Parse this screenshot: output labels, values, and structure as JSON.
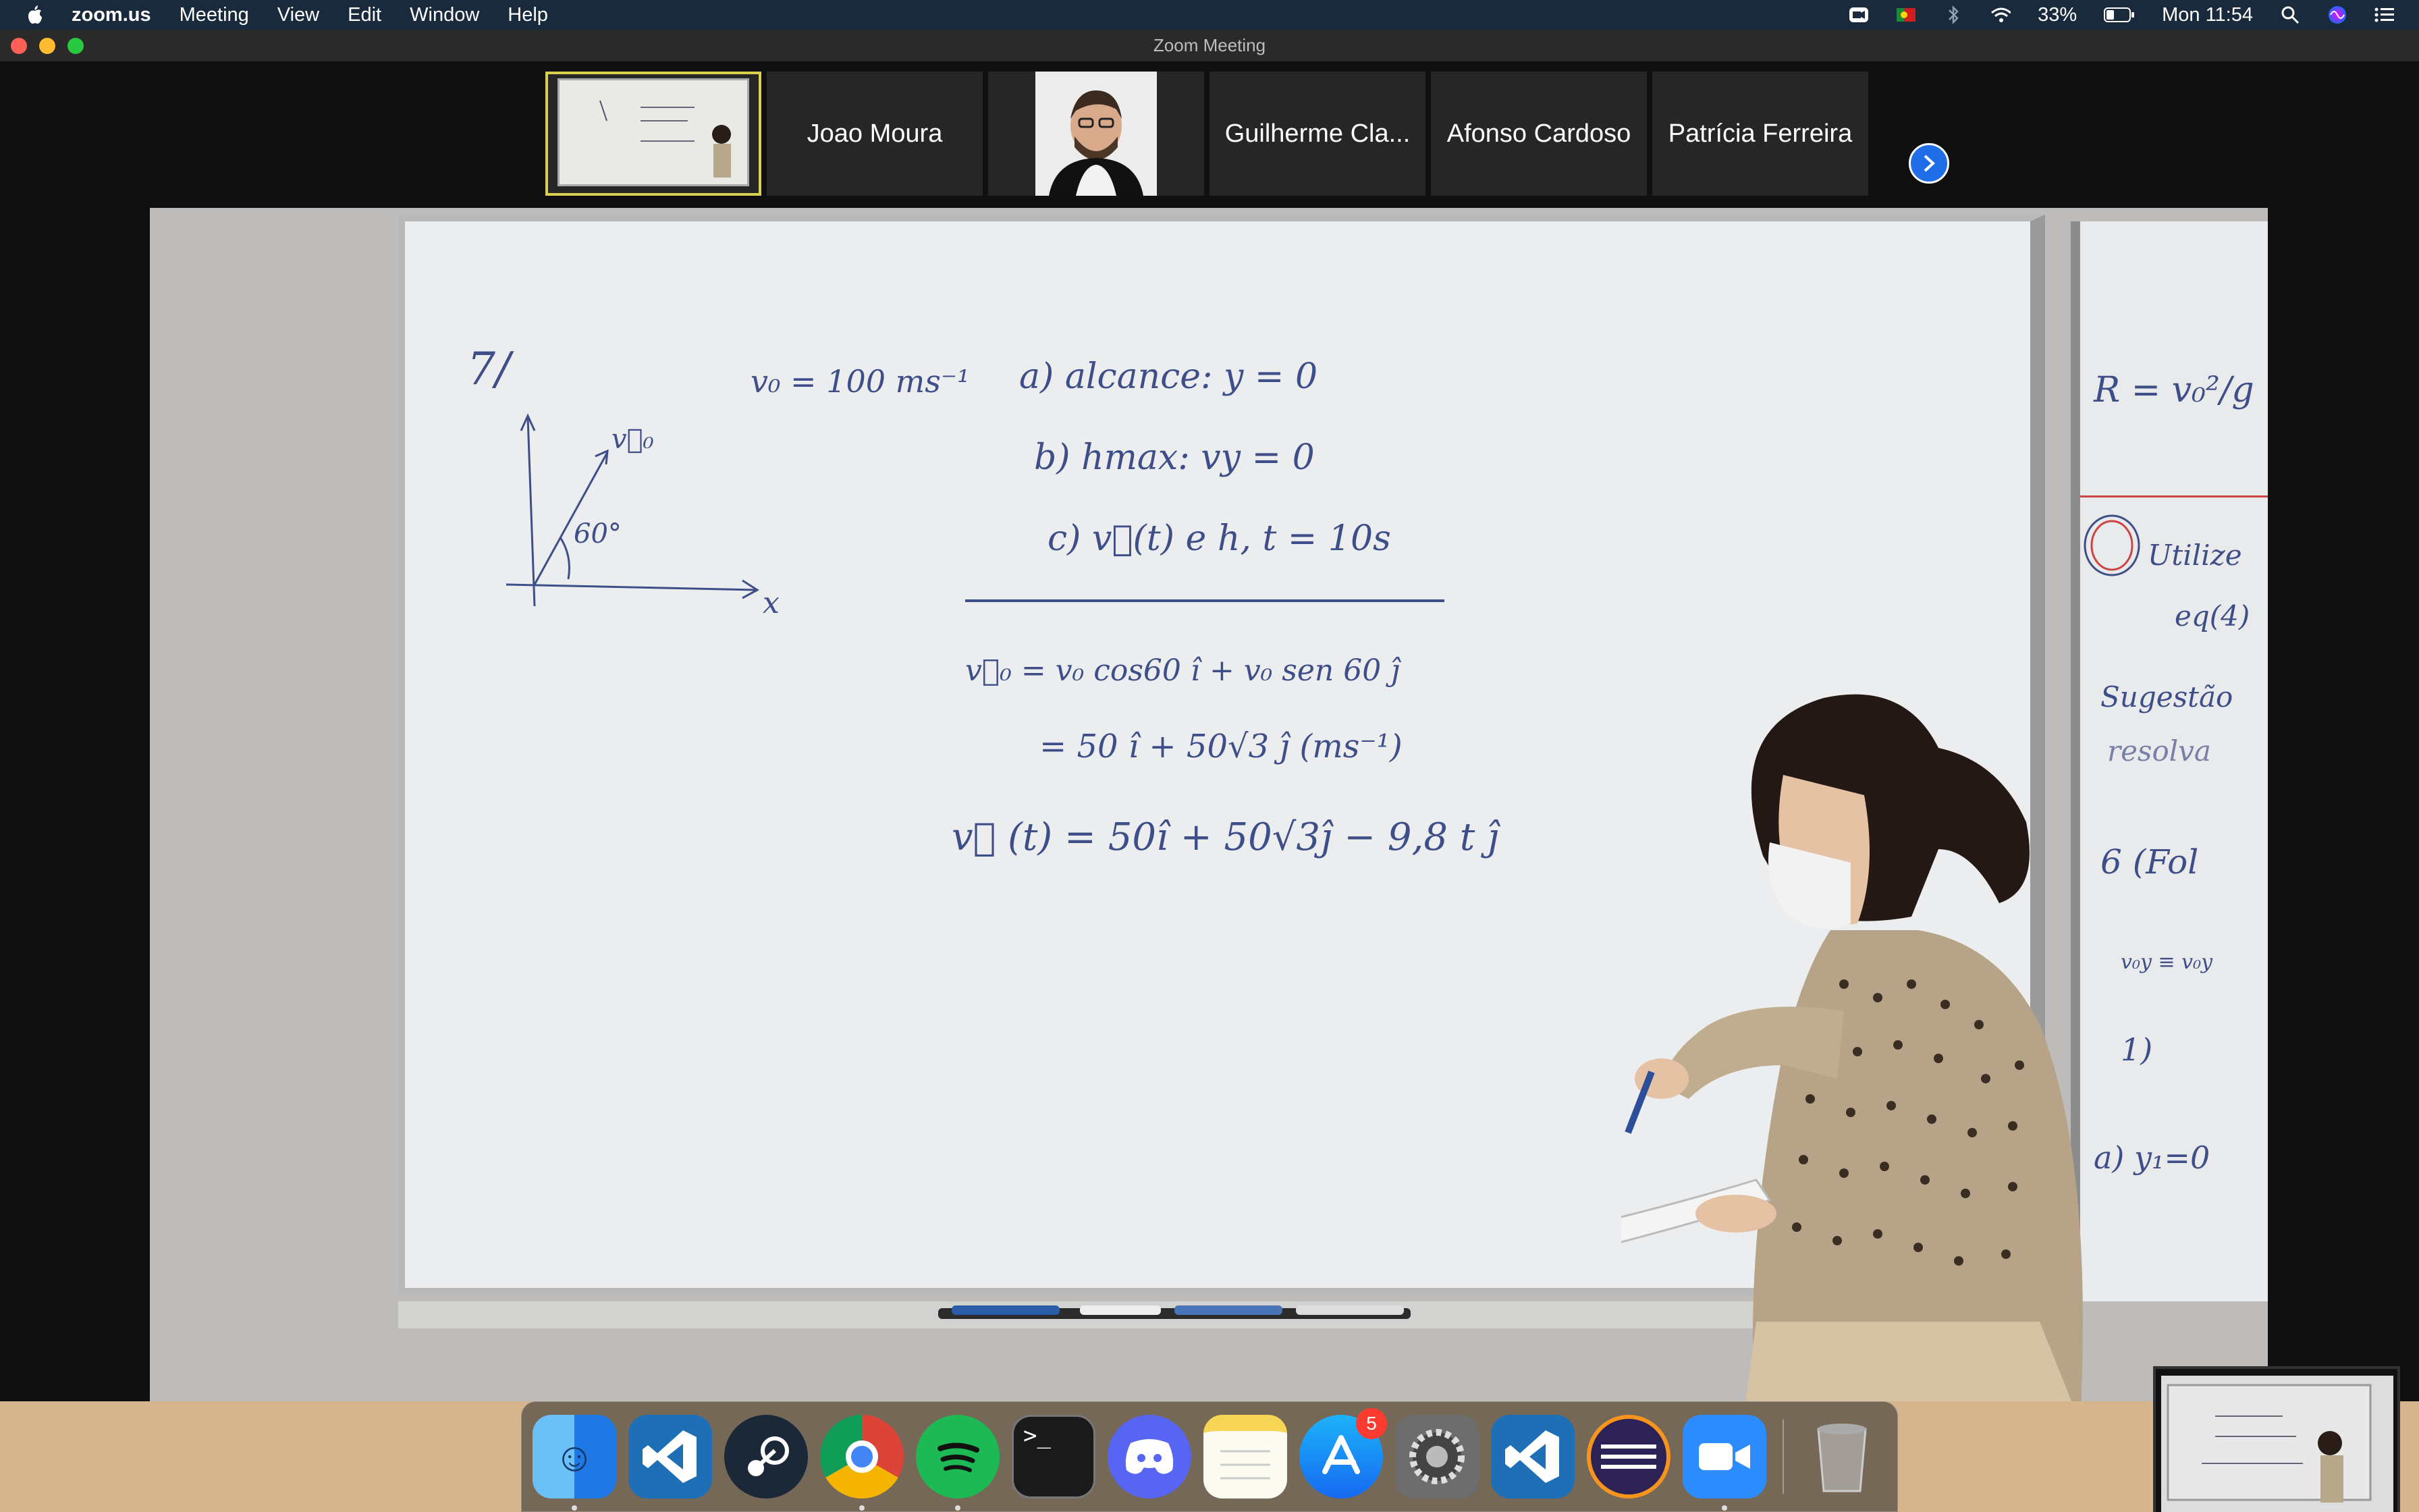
{
  "menubar": {
    "app_name": "zoom.us",
    "menus": [
      "Meeting",
      "View",
      "Edit",
      "Window",
      "Help"
    ],
    "battery": "33%",
    "clock": "Mon 11:54"
  },
  "window": {
    "title": "Zoom Meeting"
  },
  "participants": [
    {
      "name": "",
      "type": "video",
      "active": true
    },
    {
      "name": "Joao Moura",
      "type": "name"
    },
    {
      "name": "",
      "type": "video-face"
    },
    {
      "name": "Guilherme Cla...",
      "type": "name"
    },
    {
      "name": "Afonso Cardoso",
      "type": "name"
    },
    {
      "name": "Patrícia Ferreira",
      "type": "name"
    }
  ],
  "board": {
    "problem_number": "7/",
    "v0": "v₀ = 100 ms⁻¹",
    "a": "a) alcance: y = 0",
    "b": "b) hmax: vy = 0",
    "c": "c) v⃗(t) e h, t = 10s",
    "eq1": "v⃗₀ = v₀ cos60 î + v₀ sen 60 ĵ",
    "eq2": "= 50 î + 50√3 ĵ (ms⁻¹)",
    "eq3": "v⃗ (t) = 50î + 50√3ĵ − 9,8 t ĵ",
    "axis_x": "x",
    "angle": "60°",
    "vec_label": "v⃗₀"
  },
  "board_right": {
    "formula": "R = v₀²/g",
    "line1": "Utilize",
    "line2": "eq(4)",
    "line3": "Sugestão",
    "line4": "resolva",
    "line5": "6 (Fol",
    "line6": "v₀y ≡ v₀y",
    "line7": "1)",
    "line8": "a) y₁=0"
  },
  "dock": {
    "apps": [
      {
        "name": "Finder",
        "color": "#2c8cf0",
        "glyph": "☺",
        "running": true
      },
      {
        "name": "Visual Studio Code",
        "color": "#1f6fb6",
        "glyph": "⟩",
        "running": false
      },
      {
        "name": "Steam",
        "color": "#1b2838",
        "glyph": "⚙",
        "running": false
      },
      {
        "name": "Google Chrome",
        "color": "#dd4b39",
        "glyph": "◉",
        "running": true
      },
      {
        "name": "Spotify",
        "color": "#1db954",
        "glyph": "≋",
        "running": true
      },
      {
        "name": "Terminal",
        "color": "#111111",
        "glyph": ">_",
        "running": false
      },
      {
        "name": "Discord",
        "color": "#5865f2",
        "glyph": "☻",
        "running": false
      },
      {
        "name": "Notes",
        "color": "#f7e36b",
        "glyph": "≡",
        "running": false
      },
      {
        "name": "App Store",
        "color": "#1c8ef9",
        "glyph": "A",
        "running": false,
        "badge": "5"
      },
      {
        "name": "System Preferences",
        "color": "#8a8a8a",
        "glyph": "⚙",
        "running": false
      },
      {
        "name": "Visual Studio Code",
        "color": "#1f6fb6",
        "glyph": "⟩",
        "running": false
      },
      {
        "name": "Eclipse",
        "color": "#2c2255",
        "glyph": "☰",
        "running": false
      },
      {
        "name": "Zoom",
        "color": "#2d8cff",
        "glyph": "▶",
        "running": true
      }
    ],
    "trash": "Trash"
  }
}
